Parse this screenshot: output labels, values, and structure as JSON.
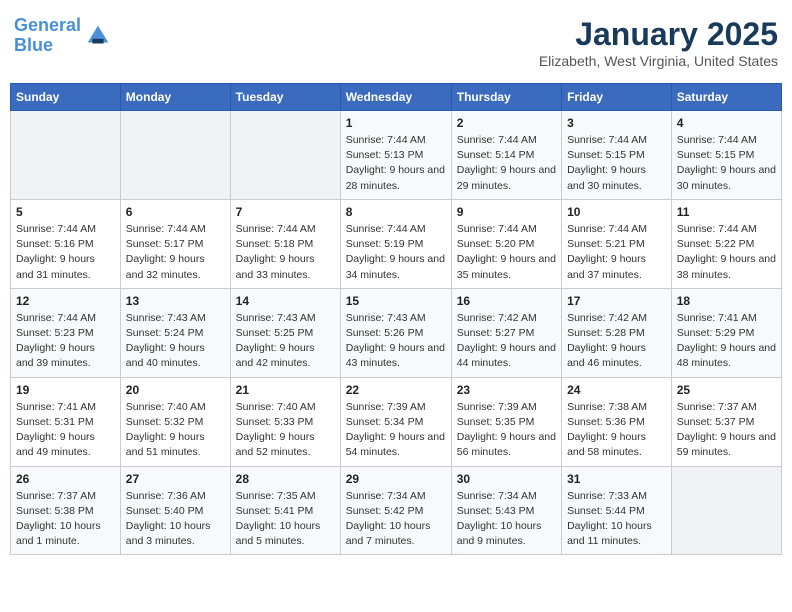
{
  "logo": {
    "line1": "General",
    "line2": "Blue"
  },
  "title": "January 2025",
  "subtitle": "Elizabeth, West Virginia, United States",
  "weekdays": [
    "Sunday",
    "Monday",
    "Tuesday",
    "Wednesday",
    "Thursday",
    "Friday",
    "Saturday"
  ],
  "weeks": [
    [
      {
        "day": "",
        "sunrise": "",
        "sunset": "",
        "daylight": ""
      },
      {
        "day": "",
        "sunrise": "",
        "sunset": "",
        "daylight": ""
      },
      {
        "day": "",
        "sunrise": "",
        "sunset": "",
        "daylight": ""
      },
      {
        "day": "1",
        "sunrise": "Sunrise: 7:44 AM",
        "sunset": "Sunset: 5:13 PM",
        "daylight": "Daylight: 9 hours and 28 minutes."
      },
      {
        "day": "2",
        "sunrise": "Sunrise: 7:44 AM",
        "sunset": "Sunset: 5:14 PM",
        "daylight": "Daylight: 9 hours and 29 minutes."
      },
      {
        "day": "3",
        "sunrise": "Sunrise: 7:44 AM",
        "sunset": "Sunset: 5:15 PM",
        "daylight": "Daylight: 9 hours and 30 minutes."
      },
      {
        "day": "4",
        "sunrise": "Sunrise: 7:44 AM",
        "sunset": "Sunset: 5:15 PM",
        "daylight": "Daylight: 9 hours and 30 minutes."
      }
    ],
    [
      {
        "day": "5",
        "sunrise": "Sunrise: 7:44 AM",
        "sunset": "Sunset: 5:16 PM",
        "daylight": "Daylight: 9 hours and 31 minutes."
      },
      {
        "day": "6",
        "sunrise": "Sunrise: 7:44 AM",
        "sunset": "Sunset: 5:17 PM",
        "daylight": "Daylight: 9 hours and 32 minutes."
      },
      {
        "day": "7",
        "sunrise": "Sunrise: 7:44 AM",
        "sunset": "Sunset: 5:18 PM",
        "daylight": "Daylight: 9 hours and 33 minutes."
      },
      {
        "day": "8",
        "sunrise": "Sunrise: 7:44 AM",
        "sunset": "Sunset: 5:19 PM",
        "daylight": "Daylight: 9 hours and 34 minutes."
      },
      {
        "day": "9",
        "sunrise": "Sunrise: 7:44 AM",
        "sunset": "Sunset: 5:20 PM",
        "daylight": "Daylight: 9 hours and 35 minutes."
      },
      {
        "day": "10",
        "sunrise": "Sunrise: 7:44 AM",
        "sunset": "Sunset: 5:21 PM",
        "daylight": "Daylight: 9 hours and 37 minutes."
      },
      {
        "day": "11",
        "sunrise": "Sunrise: 7:44 AM",
        "sunset": "Sunset: 5:22 PM",
        "daylight": "Daylight: 9 hours and 38 minutes."
      }
    ],
    [
      {
        "day": "12",
        "sunrise": "Sunrise: 7:44 AM",
        "sunset": "Sunset: 5:23 PM",
        "daylight": "Daylight: 9 hours and 39 minutes."
      },
      {
        "day": "13",
        "sunrise": "Sunrise: 7:43 AM",
        "sunset": "Sunset: 5:24 PM",
        "daylight": "Daylight: 9 hours and 40 minutes."
      },
      {
        "day": "14",
        "sunrise": "Sunrise: 7:43 AM",
        "sunset": "Sunset: 5:25 PM",
        "daylight": "Daylight: 9 hours and 42 minutes."
      },
      {
        "day": "15",
        "sunrise": "Sunrise: 7:43 AM",
        "sunset": "Sunset: 5:26 PM",
        "daylight": "Daylight: 9 hours and 43 minutes."
      },
      {
        "day": "16",
        "sunrise": "Sunrise: 7:42 AM",
        "sunset": "Sunset: 5:27 PM",
        "daylight": "Daylight: 9 hours and 44 minutes."
      },
      {
        "day": "17",
        "sunrise": "Sunrise: 7:42 AM",
        "sunset": "Sunset: 5:28 PM",
        "daylight": "Daylight: 9 hours and 46 minutes."
      },
      {
        "day": "18",
        "sunrise": "Sunrise: 7:41 AM",
        "sunset": "Sunset: 5:29 PM",
        "daylight": "Daylight: 9 hours and 48 minutes."
      }
    ],
    [
      {
        "day": "19",
        "sunrise": "Sunrise: 7:41 AM",
        "sunset": "Sunset: 5:31 PM",
        "daylight": "Daylight: 9 hours and 49 minutes."
      },
      {
        "day": "20",
        "sunrise": "Sunrise: 7:40 AM",
        "sunset": "Sunset: 5:32 PM",
        "daylight": "Daylight: 9 hours and 51 minutes."
      },
      {
        "day": "21",
        "sunrise": "Sunrise: 7:40 AM",
        "sunset": "Sunset: 5:33 PM",
        "daylight": "Daylight: 9 hours and 52 minutes."
      },
      {
        "day": "22",
        "sunrise": "Sunrise: 7:39 AM",
        "sunset": "Sunset: 5:34 PM",
        "daylight": "Daylight: 9 hours and 54 minutes."
      },
      {
        "day": "23",
        "sunrise": "Sunrise: 7:39 AM",
        "sunset": "Sunset: 5:35 PM",
        "daylight": "Daylight: 9 hours and 56 minutes."
      },
      {
        "day": "24",
        "sunrise": "Sunrise: 7:38 AM",
        "sunset": "Sunset: 5:36 PM",
        "daylight": "Daylight: 9 hours and 58 minutes."
      },
      {
        "day": "25",
        "sunrise": "Sunrise: 7:37 AM",
        "sunset": "Sunset: 5:37 PM",
        "daylight": "Daylight: 9 hours and 59 minutes."
      }
    ],
    [
      {
        "day": "26",
        "sunrise": "Sunrise: 7:37 AM",
        "sunset": "Sunset: 5:38 PM",
        "daylight": "Daylight: 10 hours and 1 minute."
      },
      {
        "day": "27",
        "sunrise": "Sunrise: 7:36 AM",
        "sunset": "Sunset: 5:40 PM",
        "daylight": "Daylight: 10 hours and 3 minutes."
      },
      {
        "day": "28",
        "sunrise": "Sunrise: 7:35 AM",
        "sunset": "Sunset: 5:41 PM",
        "daylight": "Daylight: 10 hours and 5 minutes."
      },
      {
        "day": "29",
        "sunrise": "Sunrise: 7:34 AM",
        "sunset": "Sunset: 5:42 PM",
        "daylight": "Daylight: 10 hours and 7 minutes."
      },
      {
        "day": "30",
        "sunrise": "Sunrise: 7:34 AM",
        "sunset": "Sunset: 5:43 PM",
        "daylight": "Daylight: 10 hours and 9 minutes."
      },
      {
        "day": "31",
        "sunrise": "Sunrise: 7:33 AM",
        "sunset": "Sunset: 5:44 PM",
        "daylight": "Daylight: 10 hours and 11 minutes."
      },
      {
        "day": "",
        "sunrise": "",
        "sunset": "",
        "daylight": ""
      }
    ]
  ]
}
